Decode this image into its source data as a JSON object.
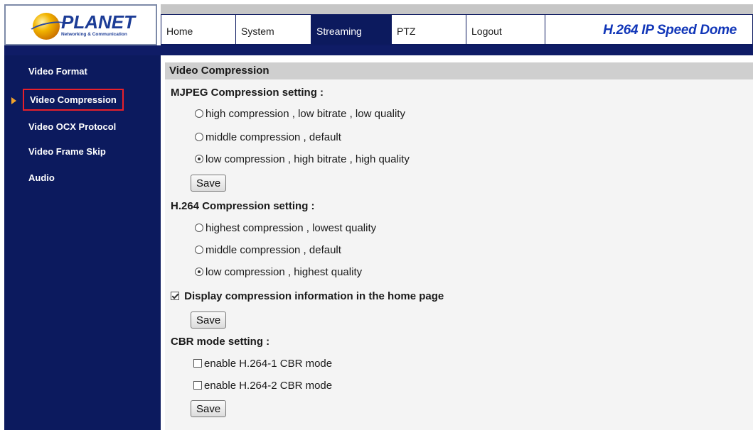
{
  "logo": {
    "name": "PLANET",
    "tagline": "Networking & Communication"
  },
  "nav": {
    "items": [
      {
        "label": "Home",
        "active": false
      },
      {
        "label": "System",
        "active": false
      },
      {
        "label": "Streaming",
        "active": true
      },
      {
        "label": "PTZ",
        "active": false
      },
      {
        "label": "Logout",
        "active": false
      }
    ],
    "brand": "H.264 IP Speed Dome"
  },
  "sidebar": {
    "items": [
      {
        "label": "Video Format",
        "selected": false
      },
      {
        "label": "Video Compression",
        "selected": true
      },
      {
        "label": "Video OCX Protocol",
        "selected": false
      },
      {
        "label": "Video Frame Skip",
        "selected": false
      },
      {
        "label": "Audio",
        "selected": false
      }
    ],
    "selected_marker_icon": "triangle-right-icon"
  },
  "main": {
    "title": "Video Compression",
    "mjpeg": {
      "title": "MJPEG Compression setting :",
      "options": [
        {
          "label": "high compression , low bitrate , low quality",
          "checked": false
        },
        {
          "label": "middle compression , default",
          "checked": false
        },
        {
          "label": "low compression , high bitrate , high quality",
          "checked": true
        }
      ],
      "save": "Save"
    },
    "h264": {
      "title": "H.264 Compression setting :",
      "options": [
        {
          "label": "highest compression , lowest quality",
          "checked": false
        },
        {
          "label": "middle compression , default",
          "checked": false
        },
        {
          "label": "low compression , highest quality",
          "checked": true
        }
      ]
    },
    "display_info": {
      "label": "Display compression information in the home page",
      "checked": true,
      "save": "Save"
    },
    "cbr": {
      "title": "CBR mode setting :",
      "options": [
        {
          "label": "enable H.264-1 CBR mode",
          "checked": false
        },
        {
          "label": "enable H.264-2 CBR mode",
          "checked": false
        }
      ],
      "save": "Save"
    }
  },
  "colors": {
    "nav_dark": "#0c1a5e",
    "brand_blue": "#1136b8",
    "selected_border": "#e8202a",
    "arrow_orange": "#f2a32b"
  }
}
